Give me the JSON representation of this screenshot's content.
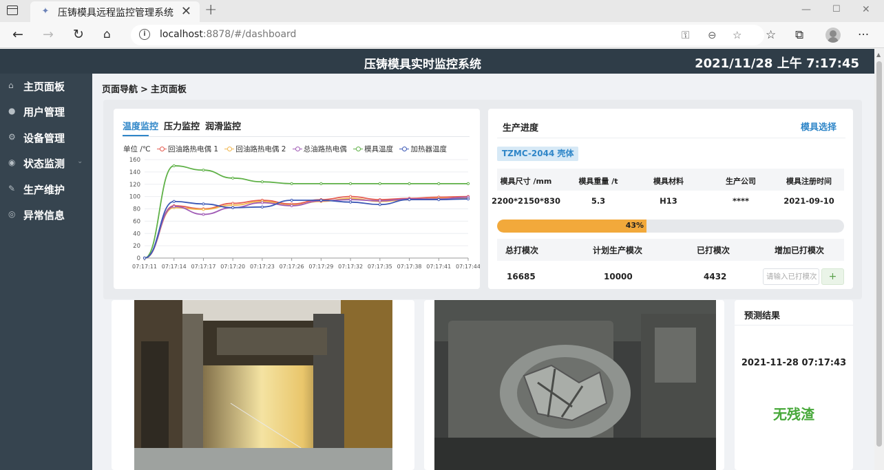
{
  "browser": {
    "tab_title": "压铸模具远程监控管理系统",
    "tab_close": "✕",
    "new_tab": "+",
    "url_host": "localhost",
    "url_rest": ":8878/#/dashboard"
  },
  "header": {
    "title": "压铸模具实时监控系统",
    "clock": "2021/11/28 上午 7:17:45"
  },
  "sidebar": {
    "items": [
      {
        "label": "主页面板",
        "icon": "home-icon"
      },
      {
        "label": "用户管理",
        "icon": "user-icon"
      },
      {
        "label": "设备管理",
        "icon": "gear-icon"
      },
      {
        "label": "状态监测",
        "icon": "monitor-icon",
        "caret": "⌄"
      },
      {
        "label": "生产维护",
        "icon": "wrench-icon"
      },
      {
        "label": "异常信息",
        "icon": "alert-icon"
      }
    ]
  },
  "breadcrumb": {
    "root": "页面导航",
    "sep": ">",
    "current": "主页面板"
  },
  "monitor": {
    "tabs": [
      "温度监控",
      "压力监控",
      "润滑监控"
    ],
    "legend_unit": "单位 /℃"
  },
  "chart_data": {
    "type": "line",
    "x": [
      "07:17:11",
      "07:17:14",
      "07:17:17",
      "07:17:20",
      "07:17:23",
      "07:17:26",
      "07:17:29",
      "07:17:32",
      "07:17:35",
      "07:17:38",
      "07:17:41",
      "07:17:44"
    ],
    "ylim": [
      0,
      160
    ],
    "yticks": [
      0,
      20,
      40,
      60,
      80,
      100,
      120,
      140,
      160
    ],
    "grid": true,
    "legend_position": "top-left",
    "series": [
      {
        "name": "回油路热电偶 1",
        "color": "#e45a4f",
        "values": [
          0,
          85,
          80,
          89,
          94,
          88,
          95,
          100,
          95,
          97,
          99,
          100
        ]
      },
      {
        "name": "回油路热电偶 2",
        "color": "#f1b64c",
        "values": [
          0,
          82,
          79,
          86,
          92,
          86,
          92,
          97,
          92,
          95,
          97,
          98
        ]
      },
      {
        "name": "总油路热电偶",
        "color": "#a05bb5",
        "values": [
          0,
          84,
          71,
          82,
          90,
          85,
          93,
          95,
          93,
          96,
          96,
          99
        ]
      },
      {
        "name": "模具温度",
        "color": "#5fb147",
        "values": [
          0,
          150,
          143,
          130,
          124,
          121,
          121,
          121,
          121,
          121,
          121,
          121
        ]
      },
      {
        "name": "加热器温度",
        "color": "#3b57b5",
        "values": [
          0,
          92,
          88,
          82,
          83,
          94,
          94,
          91,
          87,
          95,
          95,
          96
        ]
      }
    ]
  },
  "production": {
    "title": "生产进度",
    "mold_select": "模具选择",
    "mold_tag": "TZMC-2044 壳体",
    "spec_headers": [
      "模具尺寸 /mm",
      "模具重量 /t",
      "模具材料",
      "生产公司",
      "模具注册时间"
    ],
    "spec_values": [
      "2200*2150*830",
      "5.3",
      "H13",
      "****",
      "2021-09-10"
    ],
    "progress": 43,
    "progress_label": "43%",
    "count_headers": [
      "总打模次",
      "计划生产模次",
      "已打模次",
      "增加已打模次"
    ],
    "count_values": [
      "16685",
      "10000",
      "4432"
    ],
    "add_placeholder": "请输入已打模次",
    "add_button": "+"
  },
  "prediction": {
    "title": "预测结果",
    "time": "2021-11-28 07:17:43",
    "result": "无残渣"
  }
}
